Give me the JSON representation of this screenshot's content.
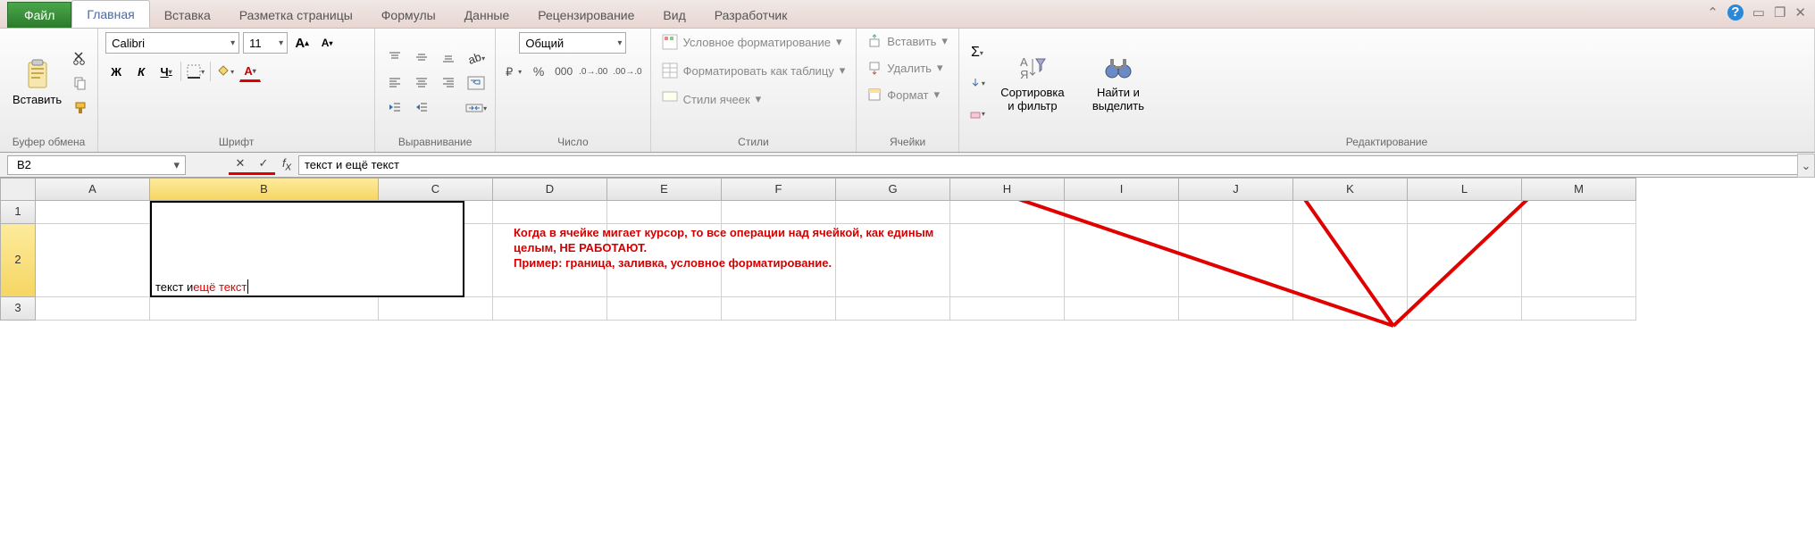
{
  "tabs": {
    "file": "Файл",
    "home": "Главная",
    "insert": "Вставка",
    "layout": "Разметка страницы",
    "formulas": "Формулы",
    "data": "Данные",
    "review": "Рецензирование",
    "view": "Вид",
    "developer": "Разработчик"
  },
  "clipboard": {
    "label": "Буфер обмена",
    "paste": "Вставить"
  },
  "font": {
    "label": "Шрифт",
    "name": "Calibri",
    "size": "11",
    "bold": "Ж",
    "italic": "К",
    "underline": "Ч"
  },
  "align": {
    "label": "Выравнивание"
  },
  "number": {
    "label": "Число",
    "format": "Общий"
  },
  "styles": {
    "label": "Стили",
    "cond": "Условное форматирование",
    "table": "Форматировать как таблицу",
    "cell": "Стили ячеек"
  },
  "cells": {
    "label": "Ячейки",
    "insert": "Вставить",
    "delete": "Удалить",
    "format": "Формат"
  },
  "edit": {
    "label": "Редактирование",
    "sort": "Сортировка и фильтр",
    "find": "Найти и выделить"
  },
  "formula_bar": {
    "name_box": "B2",
    "value": "текст и ещё текст"
  },
  "columns": [
    "A",
    "B",
    "C",
    "D",
    "E",
    "F",
    "G",
    "H",
    "I",
    "J",
    "K",
    "L",
    "M"
  ],
  "rows": [
    "1",
    "2",
    "3"
  ],
  "cell_edit": {
    "part1": "текст и ",
    "part2": "ещё текст"
  },
  "annotation": {
    "l1": "Когда в ячейке мигает курсор, то все операции над ячейкой, как единым",
    "l2": "целым, НЕ РАБОТАЮТ.",
    "l3": "Пример: граница, заливка, условное форматирование."
  }
}
